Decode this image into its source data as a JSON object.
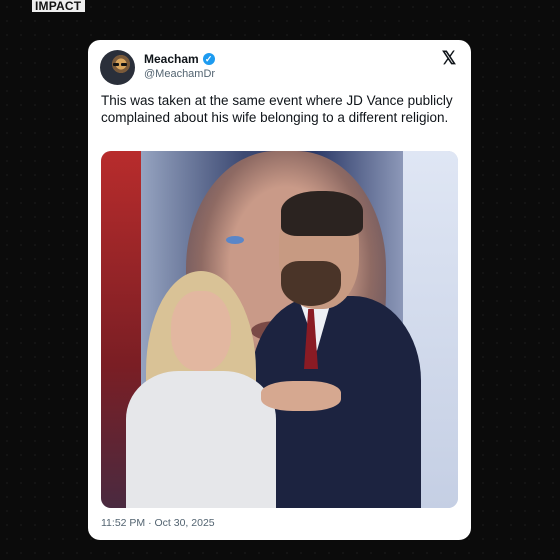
{
  "brand": {
    "label": "IMPACT"
  },
  "tweet": {
    "author_name": "Meacham",
    "verified_icon": "verified-badge-icon",
    "handle": "@MeachamDr",
    "platform_icon": "x-logo-icon",
    "text": "This was taken at the same event where JD Vance publicly complained about his wife belonging to a different religion.",
    "timestamp": "11:52 PM · Oct 30, 2025"
  },
  "colors": {
    "page_background": "#0b0b0b",
    "card_background": "#ffffff",
    "verified": "#1d9bf0",
    "secondary_text": "#536471"
  }
}
